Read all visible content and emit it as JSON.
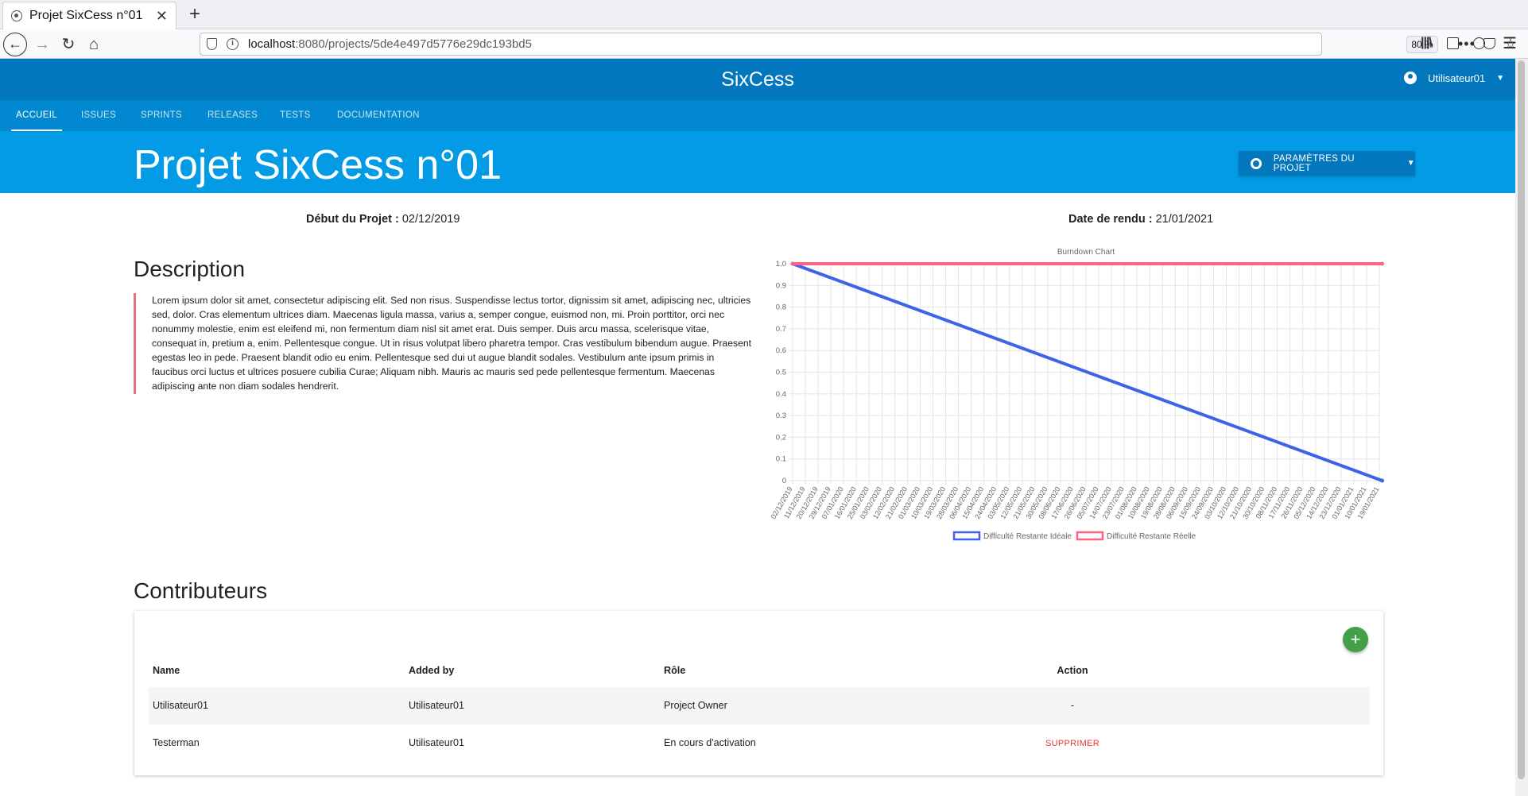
{
  "browser": {
    "tab_title": "Projet SixCess n°01",
    "url_host": "localhost",
    "url_rest": ":8080/projects/5de4e497d5776e29dc193bd5",
    "zoom": "80 %"
  },
  "header": {
    "app_title": "SixCess",
    "user_name": "Utilisateur01"
  },
  "tabs": [
    {
      "label": "ACCUEIL",
      "active": true
    },
    {
      "label": "ISSUES"
    },
    {
      "label": "SPRINTS"
    },
    {
      "label": "RELEASES"
    },
    {
      "label": "TESTS"
    },
    {
      "label": "DOCUMENTATION"
    }
  ],
  "hero": {
    "title": "Projet SixCess n°01",
    "settings_label": "PARAMÈTRES DU PROJET"
  },
  "meta": {
    "start_label": "Début du Projet :",
    "start_value": "02/12/2019",
    "due_label": "Date de rendu :",
    "due_value": "21/01/2021"
  },
  "description": {
    "title": "Description",
    "text": "Lorem ipsum dolor sit amet, consectetur adipiscing elit. Sed non risus. Suspendisse lectus tortor, dignissim sit amet, adipiscing nec, ultricies sed, dolor. Cras elementum ultrices diam. Maecenas ligula massa, varius a, semper congue, euismod non, mi. Proin porttitor, orci nec nonummy molestie, enim est eleifend mi, non fermentum diam nisl sit amet erat. Duis semper. Duis arcu massa, scelerisque vitae, consequat in, pretium a, enim. Pellentesque congue. Ut in risus volutpat libero pharetra tempor. Cras vestibulum bibendum augue. Praesent egestas leo in pede. Praesent blandit odio eu enim. Pellentesque sed dui ut augue blandit sodales. Vestibulum ante ipsum primis in faucibus orci luctus et ultrices posuere cubilia Curae; Aliquam nibh. Mauris ac mauris sed pede pellentesque fermentum. Maecenas adipiscing ante non diam sodales hendrerit."
  },
  "chart_data": {
    "type": "line",
    "title": "Burndown Chart",
    "x": [
      "02/12/2019",
      "11/12/2019",
      "20/12/2019",
      "29/12/2019",
      "07/01/2020",
      "16/01/2020",
      "25/01/2020",
      "03/02/2020",
      "12/02/2020",
      "21/02/2020",
      "01/03/2020",
      "10/03/2020",
      "19/03/2020",
      "28/03/2020",
      "06/04/2020",
      "15/04/2020",
      "24/04/2020",
      "03/05/2020",
      "12/05/2020",
      "21/05/2020",
      "30/05/2020",
      "08/06/2020",
      "17/06/2020",
      "26/06/2020",
      "05/07/2020",
      "14/07/2020",
      "23/07/2020",
      "01/08/2020",
      "10/08/2020",
      "19/08/2020",
      "28/08/2020",
      "06/09/2020",
      "15/09/2020",
      "24/09/2020",
      "03/10/2020",
      "12/10/2020",
      "21/10/2020",
      "30/10/2020",
      "08/11/2020",
      "17/11/2020",
      "26/11/2020",
      "05/12/2020",
      "14/12/2020",
      "23/12/2020",
      "01/01/2021",
      "10/01/2021",
      "19/01/2021"
    ],
    "series": [
      {
        "name": "Difficulté Restante Idéale",
        "color": "#3d63e8",
        "values": [
          1,
          0
        ]
      },
      {
        "name": "Difficulté Restante Réelle",
        "color": "#ff6384",
        "values": [
          1,
          1
        ]
      }
    ],
    "series_dates": [
      "02/12/2019",
      "21/01/2021"
    ],
    "yticks": [
      "1.0",
      "0.9",
      "0.8",
      "0.7",
      "0.6",
      "0.5",
      "0.4",
      "0.3",
      "0.2",
      "0.1",
      "0"
    ],
    "ylim": [
      0,
      1
    ],
    "grid": true,
    "legend": "bottom"
  },
  "contributors": {
    "title": "Contributeurs",
    "add_symbol": "+",
    "columns": [
      "Name",
      "Added by",
      "Rôle",
      "Action"
    ],
    "rows": [
      {
        "name": "Utilisateur01",
        "added_by": "Utilisateur01",
        "role": "Project Owner",
        "action": "-"
      },
      {
        "name": "Testerman",
        "added_by": "Utilisateur01",
        "role": "En cours d'activation",
        "action": "SUPPRIMER"
      }
    ]
  }
}
